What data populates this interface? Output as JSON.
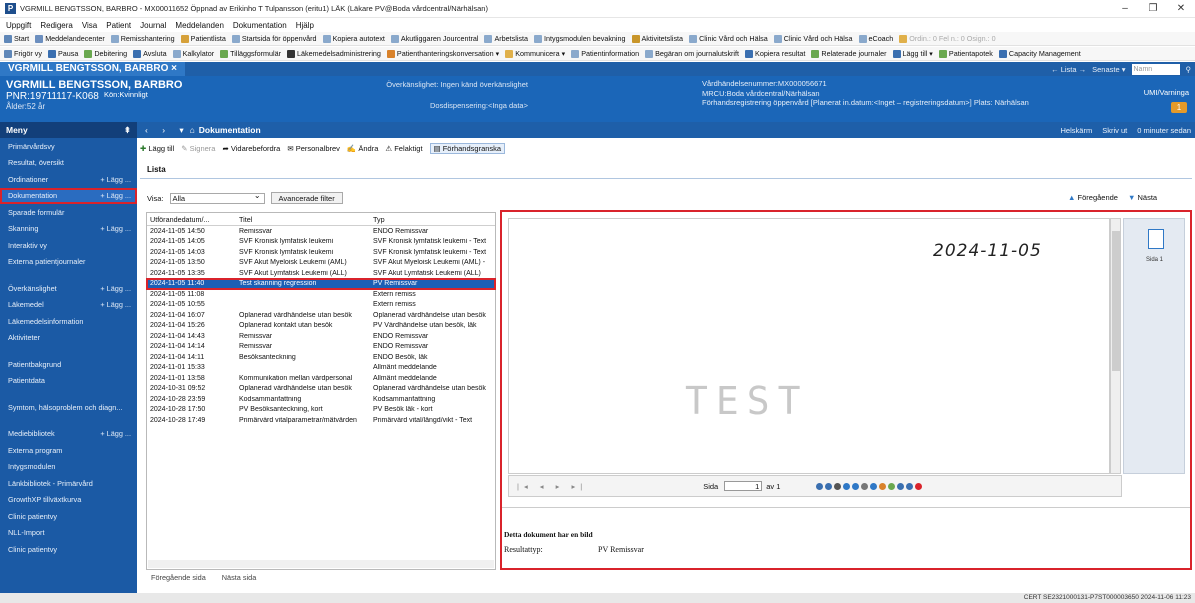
{
  "window": {
    "title": "VGRMILL BENGTSSON, BARBRO - MX00011652 Öppnad av Erikinho T Tulpansson (eritu1) LÄK (Läkare PV@Boda vårdcentral/Närhälsan)",
    "app_logo": "P",
    "minimize": "–",
    "maximize": "❐",
    "close": "✕"
  },
  "menubar": [
    "Uppgift",
    "Redigera",
    "Visa",
    "Patient",
    "Journal",
    "Meddelanden",
    "Dokumentation",
    "Hjälp"
  ],
  "toolbar1": [
    "Start",
    "Meddelandecenter",
    "Remisshantering",
    "Patientlista",
    "Startsida för öppenvård",
    "Kopiera autotext",
    "Akutliggaren Jourcentral",
    "Arbetslista",
    "Intygsmodulen bevakning",
    "Aktivitetslista",
    "Clinic Vård och Hälsa",
    "Clinic Vård och Hälsa",
    "eCoach",
    "Ordin.: 0  Fel n.: 0  Osign.: 0"
  ],
  "toolbar2": [
    "Frigör vy",
    "Pausa",
    "Debitering",
    "Avsluta",
    "Kalkylator",
    "Tilläggsformulär",
    "Läkemedelsadministrering",
    "Patienthanteringskonversation ▾",
    "Kommunicera ▾",
    "Patientinformation",
    "Begäran om journalutskrift",
    "Kopiera resultat",
    "Relaterade journaler",
    "Lägg till ▾",
    "Patientapotek",
    "Capacity Management"
  ],
  "patient_bar": {
    "name": "VGRMILL BENGTSSON, BARBRO",
    "close": "×",
    "lista": "← Lista →",
    "senaste": "Senaste ▾",
    "search_placeholder": "Namn"
  },
  "patient_header": {
    "name": "VGRMILL BENGTSSON, BARBRO",
    "pnr": "PNR:19711117-K068",
    "kon": "Kön:Kvinnligt",
    "age": "Ålder:52 år",
    "overkanslighet": "Överkänslighet: Ingen känd överkänslighet",
    "dosdispensering": "Dosdispensering:<Inga data>",
    "vardhandelse": "Vårdhändelsenummer:MX000056671",
    "mrcu": "MRCU:Boda vårdcentral/Närhälsan",
    "forhand": "Förhandsregistrering öppenvård [Planerat in.datum:<Inget – registreringsdatum>] Plats: Närhälsan",
    "umi": "UMI/Varninga",
    "warn_count": "1"
  },
  "sidebar": {
    "header": "Meny",
    "pin": "⇞",
    "items": [
      {
        "label": "Primärvårdsvy",
        "add": ""
      },
      {
        "label": "Resultat, översikt",
        "add": ""
      },
      {
        "label": "Ordinationer",
        "add": "+ Lägg ..."
      },
      {
        "label": "Dokumentation",
        "add": "+ Lägg ..."
      },
      {
        "label": "Sparade formulär",
        "add": ""
      },
      {
        "label": "Skanning",
        "add": "+ Lägg ..."
      },
      {
        "label": "Interaktiv vy",
        "add": ""
      },
      {
        "label": "Externa patientjournaler",
        "add": ""
      },
      {
        "label": "Överkänslighet",
        "add": "+ Lägg ..."
      },
      {
        "label": "Läkemedel",
        "add": "+ Lägg ..."
      },
      {
        "label": "Läkemedelsinformation",
        "add": ""
      },
      {
        "label": "Aktiviteter",
        "add": ""
      },
      {
        "label": "Patientbakgrund",
        "add": ""
      },
      {
        "label": "Patientdata",
        "add": ""
      },
      {
        "label": "Symtom, hälsoproblem och diagn...",
        "add": ""
      },
      {
        "label": "Mediebibliotek",
        "add": "+ Lägg ..."
      },
      {
        "label": "Externa program",
        "add": ""
      },
      {
        "label": "Intygsmodulen",
        "add": ""
      },
      {
        "label": "Länkbibliotek - Primärvård",
        "add": ""
      },
      {
        "label": "GrowthXP tillväxtkurva",
        "add": ""
      },
      {
        "label": "Clinic patientvy",
        "add": ""
      },
      {
        "label": "NLL-Import",
        "add": ""
      },
      {
        "label": "Clinic patientvy",
        "add": ""
      }
    ]
  },
  "docbar": {
    "title": "Dokumentation",
    "helskarm": "Helskärm",
    "skriv_ut": "Skriv ut",
    "updated": "0 minuter sedan"
  },
  "actions": {
    "lagg_till": "Lägg till",
    "signera": "Signera",
    "vidarebefordra": "Vidarebefordra",
    "personalbrev": "Personalbrev",
    "andra": "Ändra",
    "felaktigt": "Felaktigt",
    "forhandsgranska": "Förhandsgranska"
  },
  "list": {
    "title": "Lista",
    "visa_label": "Visa:",
    "visa_value": "Alla",
    "advanced": "Avancerade filter",
    "foregaende": "Föregående",
    "nasta": "Nästa",
    "headers": [
      "Utförandedatum/...",
      "Titel",
      "Typ"
    ],
    "rows": [
      [
        "2024-11-05 14:50",
        "Remissvar",
        "ENDO Remissvar"
      ],
      [
        "2024-11-05 14:05",
        "SVF Kronisk lymfatisk leukemi",
        "SVF Kronisk lymfatisk leukemi - Text"
      ],
      [
        "2024-11-05 14:03",
        "SVF Kronisk lymfatisk leukemi",
        "SVF Kronisk lymfatisk leukemi - Text"
      ],
      [
        "2024-11-05 13:50",
        "SVF Akut Myeloisk Leukemi (AML)",
        "SVF Akut Myeloisk Leukemi (AML) -"
      ],
      [
        "2024-11-05 13:35",
        "SVF Akut Lymfatisk Leukemi (ALL)",
        "SVF Akut Lymfatisk Leukemi (ALL)"
      ],
      [
        "2024-11-05 11:40",
        "Test skanning regression",
        "PV Remissvar"
      ],
      [
        "2024-11-05 11:08",
        "",
        "Extern remiss"
      ],
      [
        "2024-11-05 10:55",
        "",
        "Extern remiss"
      ],
      [
        "2024-11-04 16:07",
        "Oplanerad vårdhändelse utan besök",
        "Oplanerad vårdhändelse utan besök"
      ],
      [
        "2024-11-04 15:26",
        "Oplanerad kontakt utan besök",
        "PV Vårdhändelse utan besök, läk"
      ],
      [
        "2024-11-04 14:43",
        "Remissvar",
        "ENDO Remissvar"
      ],
      [
        "2024-11-04 14:14",
        "Remissvar",
        "ENDO Remissvar"
      ],
      [
        "2024-11-04 14:11",
        "Besöksanteckning",
        "ENDO Besök, läk"
      ],
      [
        "2024-11-01 15:33",
        "",
        "Allmänt meddelande"
      ],
      [
        "2024-11-01 13:58",
        "Kommunikation mellan vårdpersonal",
        "Allmänt meddelande"
      ],
      [
        "2024-10-31 09:52",
        "Oplanerad vårdhändelse utan besök",
        "Oplanerad vårdhändelse utan besök"
      ],
      [
        "2024-10-28 23:59",
        "Kodsammanfattning",
        "Kodsammanfattning"
      ],
      [
        "2024-10-28 17:50",
        "PV Besöksanteckning, kort",
        "PV Besök läk - kort"
      ],
      [
        "2024-10-28 17:49",
        "Primärvård vitalparametrar/mätvärden",
        "Primärvård vital/längd/vikt - Text"
      ]
    ],
    "selected_index": 5,
    "prev_page": "Föregående sida",
    "next_page": "Nästa sida"
  },
  "viewer": {
    "handwritten_date": "2024-11-05",
    "scan_text": "TEST",
    "page_label": "Sida",
    "page_value": "1",
    "page_of": "av 1",
    "thumb_label": "Sida 1",
    "info_heading": "Detta dokument har en bild",
    "resultattyp_label": "Resultattyp:",
    "resultattyp_value": "PV Remissvar"
  },
  "status": {
    "text": "CERT  SE2321000131-P7ST000003650  2024-11-06  11:23"
  },
  "colors": {
    "accent_red": "#d9232b",
    "brand_blue": "#1b5aa5",
    "selection_blue": "#1c5fb5"
  }
}
